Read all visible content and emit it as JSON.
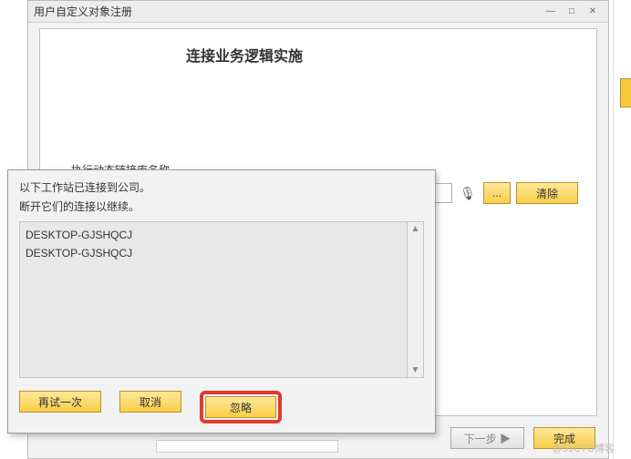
{
  "main": {
    "title": "用户自定义对象注册",
    "heading": "连接业务逻辑实施",
    "field_label": "执行动态链接库名称",
    "browse_label": "...",
    "clear_label": "清除",
    "next_label": "下一步 ▶",
    "finish_label": "完成"
  },
  "modal": {
    "line1": "以下工作站已连接到公司。",
    "line2": "断开它们的连接以继续。",
    "items": [
      "DESKTOP-GJSHQCJ",
      "DESKTOP-GJSHQCJ"
    ],
    "retry_label": "再试一次",
    "cancel_label": "取消",
    "ignore_label": "忽略"
  },
  "icons": {
    "min": "—",
    "max": "□",
    "close": "✕",
    "arrow_up": "▲",
    "arrow_down": "▼",
    "mic": "🎙"
  },
  "watermark": "@51CTO博客"
}
